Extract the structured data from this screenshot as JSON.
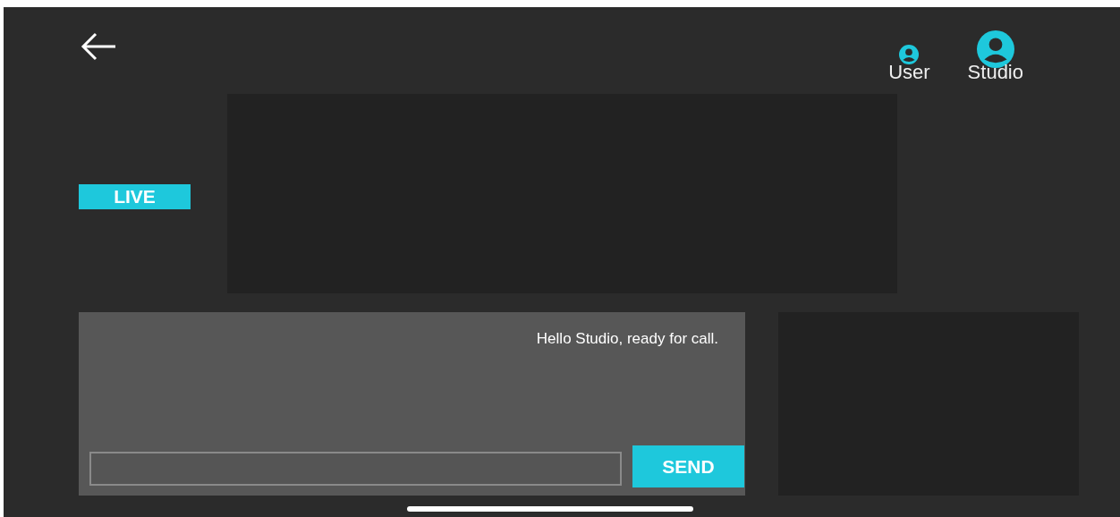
{
  "participants": [
    {
      "name": "User",
      "selected": false
    },
    {
      "name": "Studio",
      "selected": true
    }
  ],
  "live_badge": "LIVE",
  "chat": {
    "messages": [
      "Hello Studio, ready for call."
    ],
    "send_button": "SEND"
  }
}
